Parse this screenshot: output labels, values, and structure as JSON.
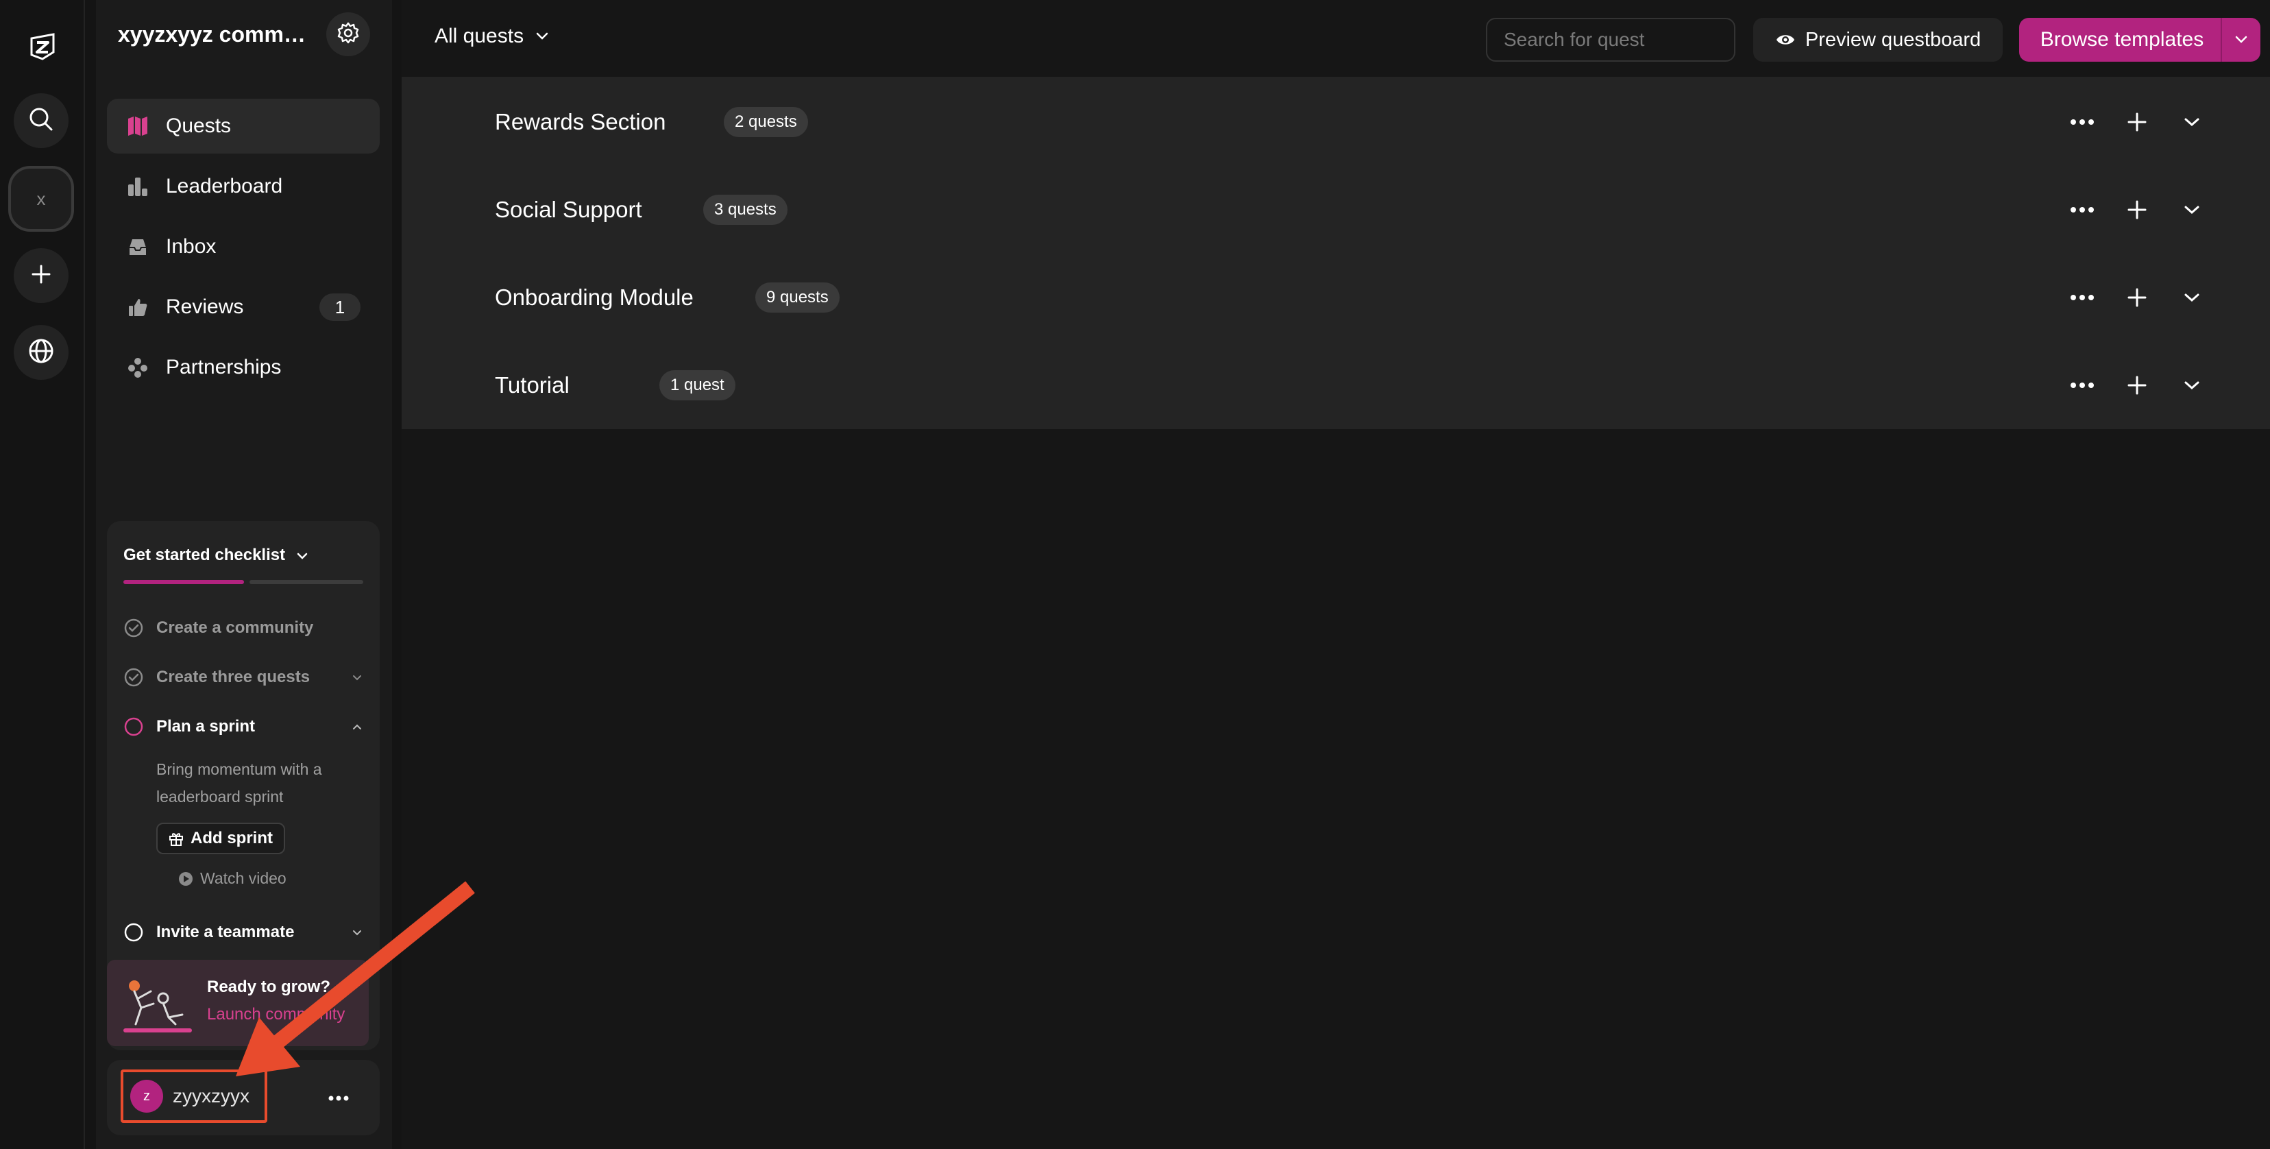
{
  "rail": {
    "logo_icon": "zealy-logo-icon",
    "community_initial": "x",
    "items": [
      "search-icon",
      "community-x",
      "plus-icon",
      "globe-icon"
    ]
  },
  "sidebar": {
    "community_name": "xyyzxyyz commun...",
    "nav": [
      {
        "label": "Quests",
        "icon": "map-icon",
        "active": true
      },
      {
        "label": "Leaderboard",
        "icon": "bar-chart-icon"
      },
      {
        "label": "Inbox",
        "icon": "inbox-icon"
      },
      {
        "label": "Reviews",
        "icon": "thumbs-up-icon",
        "badge": "1"
      },
      {
        "label": "Partnerships",
        "icon": "puzzle-icon"
      }
    ],
    "checklist": {
      "title": "Get started checklist",
      "progress": 0.5,
      "items": [
        {
          "label": "Create a community",
          "status": "done"
        },
        {
          "label": "Create three quests",
          "status": "done"
        },
        {
          "label": "Plan a sprint",
          "status": "todo",
          "expanded": true
        },
        {
          "label": "Invite a teammate",
          "status": "todo"
        }
      ],
      "sprint_description": "Bring momentum with a leaderboard sprint",
      "add_sprint_label": "Add sprint",
      "watch_video_label": "Watch video"
    },
    "grow_card": {
      "title": "Ready to grow?",
      "link": "Launch community"
    },
    "user": {
      "initial": "z",
      "name": "zyyxzyyx"
    }
  },
  "topbar": {
    "filter_label": "All quests",
    "search_placeholder": "Search for quest",
    "preview_label": "Preview questboard",
    "browse_label": "Browse templates"
  },
  "sections": [
    {
      "name": "Rewards Section",
      "count": "2 quests"
    },
    {
      "name": "Social Support",
      "count": "3 quests"
    },
    {
      "name": "Onboarding Module",
      "count": "9 quests"
    },
    {
      "name": "Tutorial",
      "count": "1 quest"
    }
  ],
  "colors": {
    "accent": "#b2237f",
    "annotation": "#e84b2d"
  }
}
